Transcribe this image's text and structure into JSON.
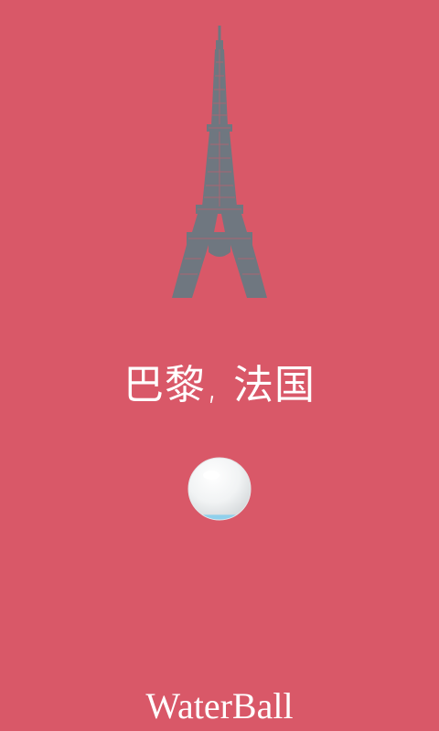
{
  "screen": {
    "background_color": "#d95868"
  },
  "illustration": {
    "icon": "eiffel-tower-icon",
    "color": "#6f7780"
  },
  "city_title": "巴黎, 法国",
  "water_ball": {
    "icon": "water-ball-icon",
    "fill_level": 0.08,
    "water_color": "#8fd0ec"
  },
  "app_name": "WaterBall"
}
